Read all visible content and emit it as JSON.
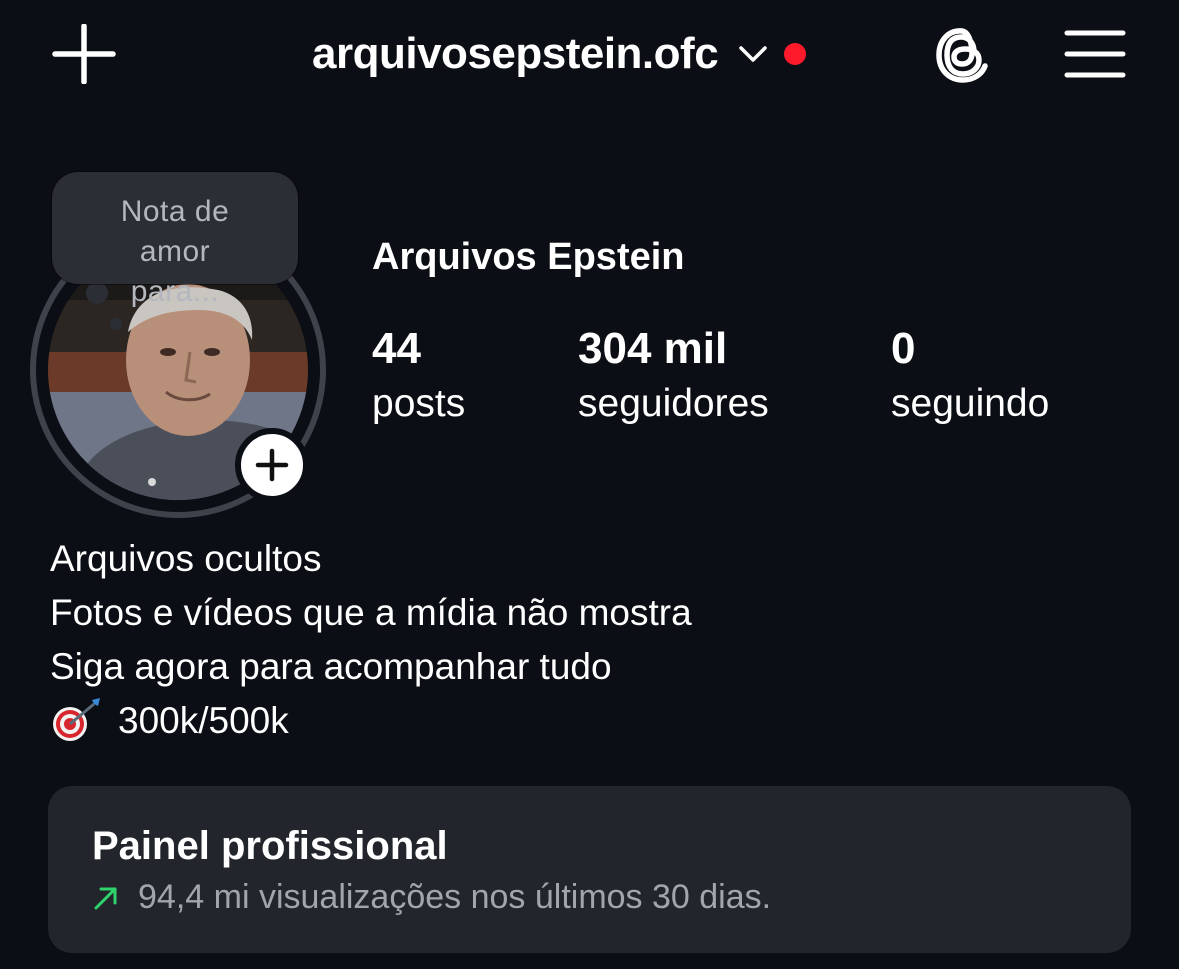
{
  "header": {
    "username": "arquivosepstein.ofc",
    "icons": [
      "plus-icon",
      "chevron-down-icon",
      "threads-icon",
      "menu-icon"
    ],
    "notification_dot_color": "#ff1a2b"
  },
  "profile": {
    "note": "Nota de amor para...",
    "display_name": "Arquivos Epstein",
    "stats": [
      {
        "value": "44",
        "label": "posts"
      },
      {
        "value": "304 mil",
        "label": "seguidores"
      },
      {
        "value": "0",
        "label": "seguindo"
      }
    ]
  },
  "bio": {
    "lines": [
      "Arquivos ocultos",
      "Fotos e vídeos que a mídia não mostra",
      "Siga agora para acompanhar tudo",
      "300k/500k"
    ],
    "goal_icon": "direct-hit-icon"
  },
  "professional_panel": {
    "title": "Painel profissional",
    "subtitle": "94,4 mi visualizações nos últimos 30 dias.",
    "trend_color": "#2fd36b"
  }
}
